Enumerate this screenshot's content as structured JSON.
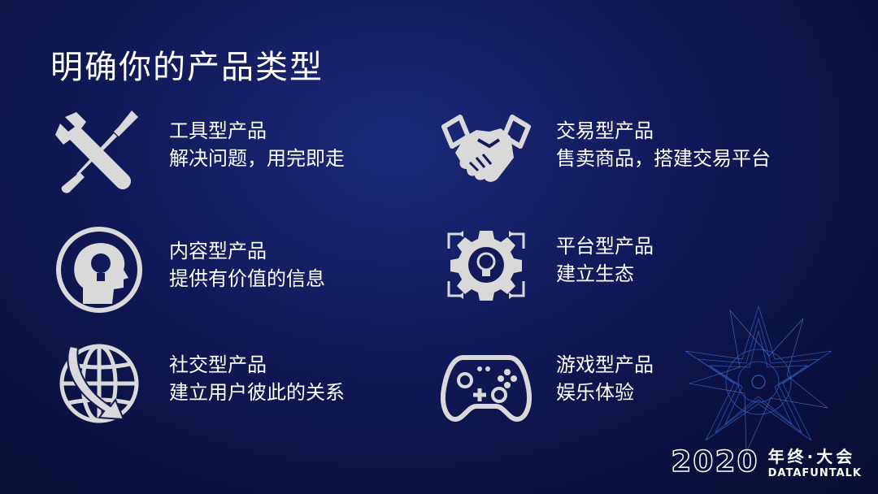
{
  "slide": {
    "title": "明确你的产品类型",
    "colors": {
      "icon": "#d9d9d9",
      "text": "#ffffff",
      "background": "#111a5a"
    }
  },
  "items": [
    {
      "icon": "tools-icon",
      "name": "工具型产品",
      "desc": "解决问题，用完即走"
    },
    {
      "icon": "head-bulb-icon",
      "name": "内容型产品",
      "desc": "提供有价值的信息"
    },
    {
      "icon": "globe-arrow-icon",
      "name": "社交型产品",
      "desc": "建立用户彼此的关系"
    },
    {
      "icon": "handshake-icon",
      "name": "交易型产品",
      "desc": "售卖商品，搭建交易平台"
    },
    {
      "icon": "gear-cycle-icon",
      "name": "平台型产品",
      "desc": "建立生态"
    },
    {
      "icon": "gamepad-icon",
      "name": "游戏型产品",
      "desc": "娱乐体验"
    }
  ],
  "logo": {
    "year": "2020",
    "cn": "年终·大会",
    "en": "DATAFUNTALK"
  }
}
